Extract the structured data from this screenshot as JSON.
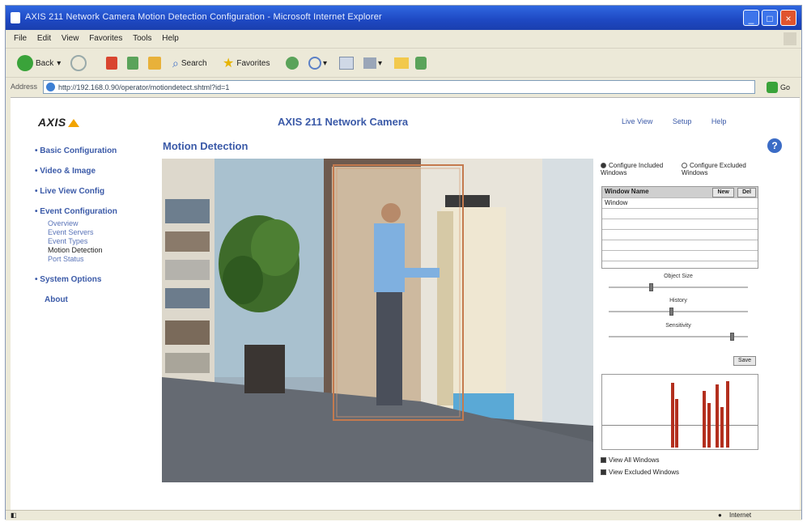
{
  "window": {
    "title": "AXIS 211 Network Camera Motion Detection Configuration - Microsoft Internet Explorer",
    "controls": [
      "_",
      "□",
      "×"
    ]
  },
  "menubar": [
    "File",
    "Edit",
    "View",
    "Favorites",
    "Tools",
    "Help"
  ],
  "toolbar": {
    "back_label": "Back",
    "search_label": "Search",
    "favorites_label": "Favorites"
  },
  "addressbar": {
    "label": "Address",
    "url": "http://192.168.0.90/operator/motiondetect.shtml?id=1",
    "go_label": "Go"
  },
  "header": {
    "logo_text": "AXIS",
    "page_title": "AXIS 211 Network Camera",
    "links": [
      "Live View",
      "Setup",
      "Help"
    ]
  },
  "sidebar": {
    "items": [
      {
        "label": "Basic Configuration"
      },
      {
        "label": "Video & Image"
      },
      {
        "label": "Live View Config"
      },
      {
        "label": "Event Configuration"
      },
      {
        "label": "System Options"
      },
      {
        "label": "About"
      }
    ],
    "event_subitems": [
      "Overview",
      "Event Servers",
      "Event Types",
      "Motion Detection",
      "Port Status"
    ],
    "active_subitem": "Motion Detection"
  },
  "section": {
    "title": "Motion Detection"
  },
  "panel": {
    "radio_include": "Configure Included Windows",
    "radio_exclude": "Configure Excluded Windows",
    "table_header": "Window Name",
    "new_label": "New",
    "del_label": "Del",
    "windows": [
      "Window"
    ],
    "sliders": [
      {
        "label": "Object Size",
        "value": 0.3
      },
      {
        "label": "History",
        "value": 0.45
      },
      {
        "label": "Sensitivity",
        "value": 0.9
      }
    ],
    "save_label": "Save",
    "show_all_label": "View All Windows",
    "show_excluded_label": "View Excluded Windows"
  },
  "statusbar": {
    "zone": "Internet"
  }
}
